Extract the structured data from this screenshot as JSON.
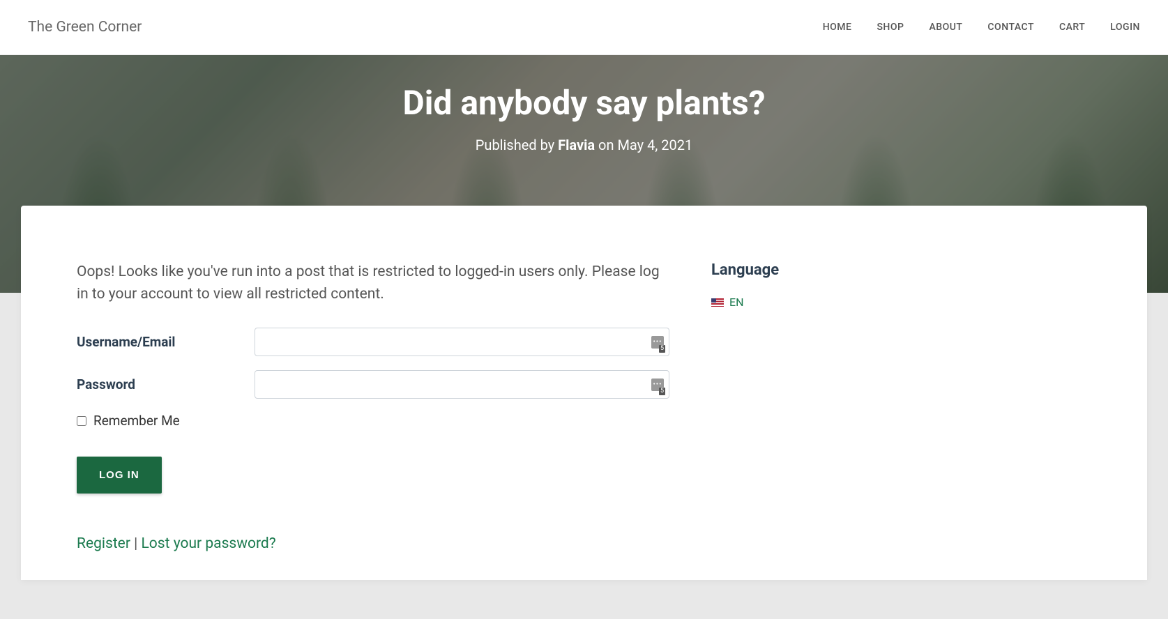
{
  "brand": "The Green Corner",
  "nav": {
    "items": [
      {
        "label": "HOME"
      },
      {
        "label": "SHOP"
      },
      {
        "label": "ABOUT"
      },
      {
        "label": "CONTACT"
      },
      {
        "label": "CART"
      },
      {
        "label": "LOGIN"
      }
    ]
  },
  "hero": {
    "title": "Did anybody say plants?",
    "published_prefix": "Published by ",
    "author": "Flavia",
    "published_suffix": " on May 4, 2021"
  },
  "content": {
    "restricted_message": "Oops! Looks like you've run into a post that is restricted to logged-in users only. Please log in to your account to view all restricted content."
  },
  "form": {
    "username_label": "Username/Email",
    "password_label": "Password",
    "remember_label": "Remember Me",
    "login_button": "LOG IN",
    "badge_count": "5"
  },
  "auth_links": {
    "register": "Register",
    "separator": " | ",
    "lost_password": "Lost your password?"
  },
  "sidebar": {
    "language_heading": "Language",
    "language_item": "EN"
  }
}
